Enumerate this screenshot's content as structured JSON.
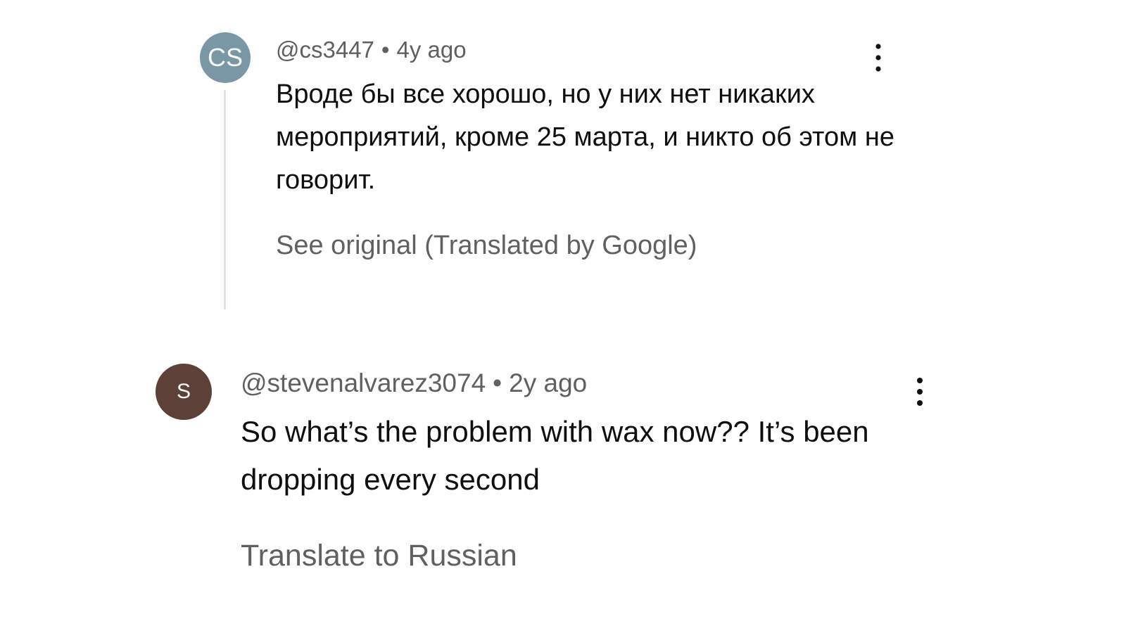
{
  "comments": [
    {
      "avatar_initials": "CS",
      "avatar_color": "#7a97a6",
      "handle": "@cs3447",
      "separator": "•",
      "age": "4y ago",
      "text": "Вроде бы все хорошо, но у них нет никаких мероприятий, кроме 25 марта, и никто об этом не говорит.",
      "translate_link": "See original (Translated by Google)",
      "menu_icon": "more-vertical-icon"
    },
    {
      "avatar_initials": "S",
      "avatar_color": "#5d4037",
      "handle": "@stevenalvarez3074",
      "separator": "•",
      "age": "2y ago",
      "text": "So what’s the problem with wax now?? It’s been dropping every second",
      "translate_link": "Translate to Russian",
      "menu_icon": "more-vertical-icon"
    }
  ],
  "colors": {
    "thread_line": "#e2e2e2",
    "meta_text": "#606060",
    "body_text": "#0f0f0f"
  }
}
